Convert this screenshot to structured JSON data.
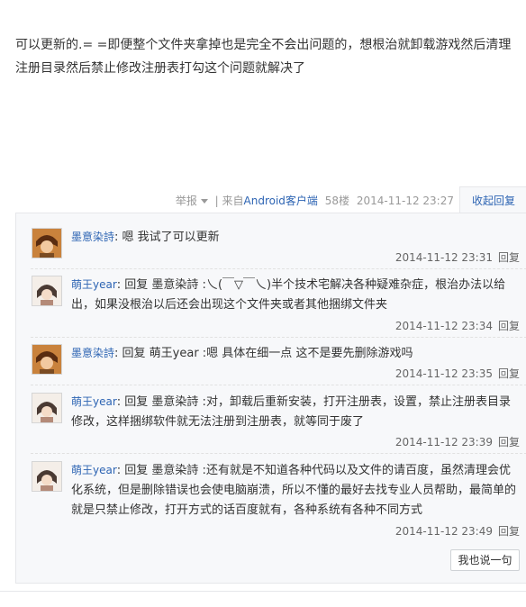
{
  "post": {
    "content": "可以更新的.= =即便整个文件夹拿掉也是完全不会出问题的，想根治就卸载游戏然后清理注册目录然后禁止修改注册表打勾这个问题就解决了",
    "report_label": "举报",
    "source_prefix": "| 来自",
    "source_link": "Android客户端",
    "floor": "58楼",
    "time": "2014-11-12 23:27",
    "collapse_label": "收起回复"
  },
  "replies": [
    {
      "user": "墨意染詩",
      "text": "嗯 我试了可以更新",
      "time": "2014-11-12 23:31",
      "reply_label": "回复"
    },
    {
      "user": "萌王year",
      "text": "回复 墨意染詩 :乀(￣▽￣乀)半个技术宅解决各种疑难杂症，根治办法以给出，如果没根治以后还会出现这个文件夹或者其他捆绑文件夹",
      "time": "2014-11-12 23:34",
      "reply_label": "回复"
    },
    {
      "user": "墨意染詩",
      "text": "回复 萌王year :嗯 具体在细一点 这不是要先删除游戏吗",
      "time": "2014-11-12 23:35",
      "reply_label": "回复"
    },
    {
      "user": "萌王year",
      "text": "回复 墨意染詩 :对，卸载后重新安装，打开注册表，设置，禁止注册表目录修改，这样捆绑软件就无法注册到注册表，就等同于废了",
      "time": "2014-11-12 23:39",
      "reply_label": "回复"
    },
    {
      "user": "萌王year",
      "text": "回复 墨意染詩 :还有就是不知道各种代码以及文件的请百度，虽然清理会优化系统，但是删除错误也会使电脑崩溃，所以不懂的最好去找专业人员帮助，最简单的就是只禁止修改，打开方式的话百度就有，各种系统有各种不同方式",
      "time": "2014-11-12 23:49",
      "reply_label": "回复"
    }
  ],
  "say_button": "我也说一句"
}
